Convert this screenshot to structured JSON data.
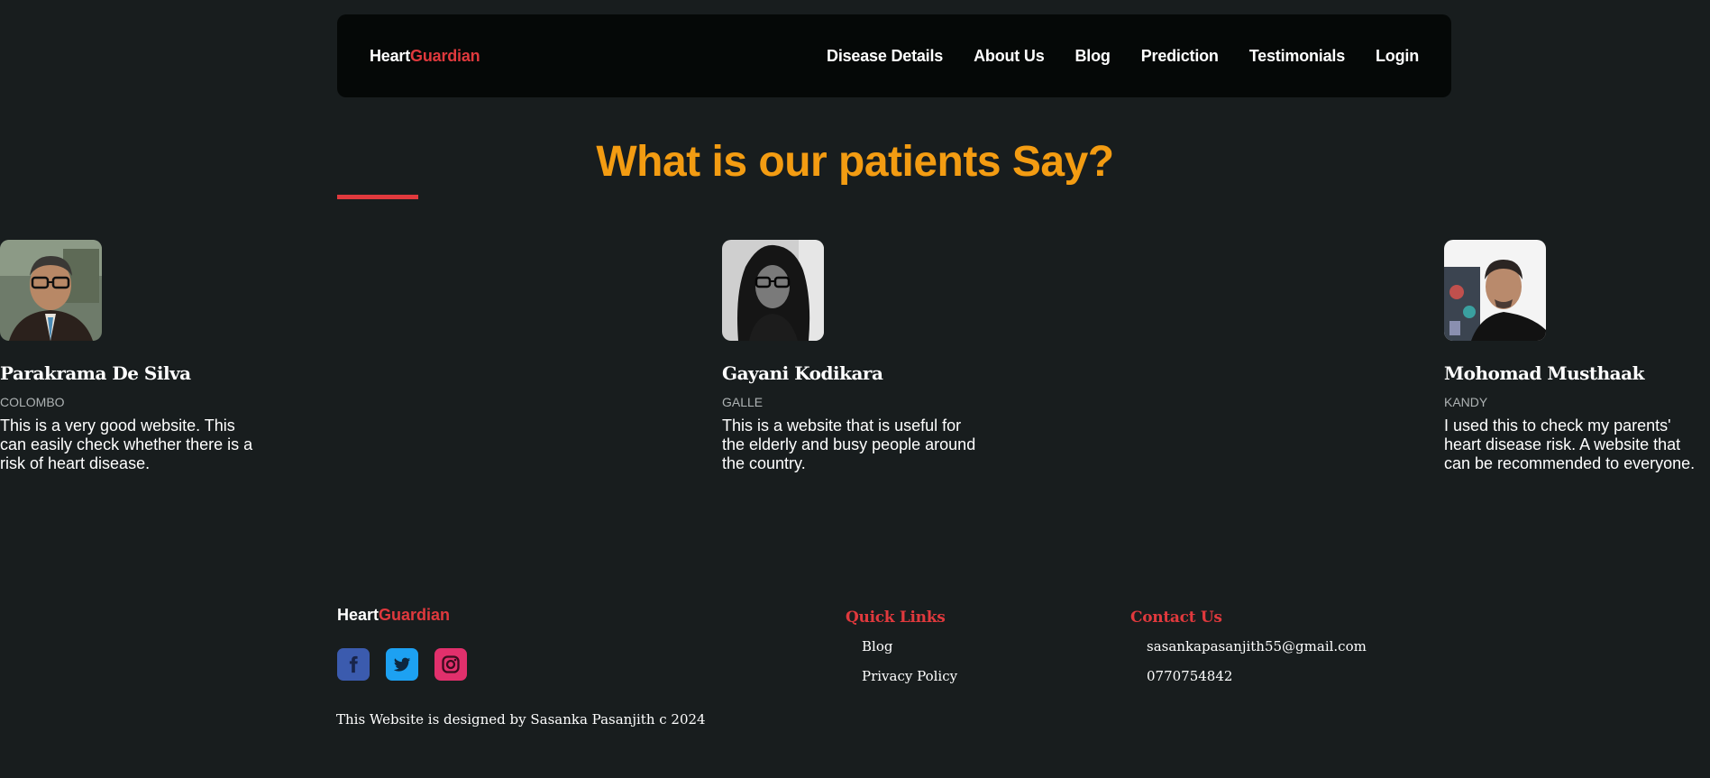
{
  "nav": {
    "brand_part1": "Heart",
    "brand_part2": "Guardian",
    "links": [
      "Disease Details",
      "About Us",
      "Blog",
      "Prediction",
      "Testimonials",
      "Login"
    ]
  },
  "testimonials": {
    "title": "What is our patients Say?",
    "items": [
      {
        "name": "Parakrama De Silva",
        "city": "COLOMBO",
        "quote": "This is a very good website. This can easily check whether there is a risk of heart disease."
      },
      {
        "name": "Gayani Kodikara",
        "city": "GALLE",
        "quote": "This is a website that is useful for the elderly and busy people around the country."
      },
      {
        "name": "Mohomad Musthaak",
        "city": "KANDY",
        "quote": "I used this to check my parents' heart disease risk. A website that can be recommended to everyone."
      }
    ]
  },
  "footer": {
    "brand_part1": "Heart",
    "brand_part2": "Guardian",
    "socials": [
      "facebook-icon",
      "twitter-icon",
      "instagram-icon"
    ],
    "credit": "This Website is designed by Sasanka Pasanjith c 2024",
    "quick_links_title": "Quick Links",
    "quick_links": [
      "Blog",
      "Privacy Policy"
    ],
    "contact_title": "Contact Us",
    "contact": [
      "sasankapasanjith55@gmail.com",
      "0770754842"
    ]
  },
  "colors": {
    "background": "#181d1e",
    "navbar": "#050807",
    "accent_red": "#e0393d",
    "title_orange": "#f39c12"
  }
}
